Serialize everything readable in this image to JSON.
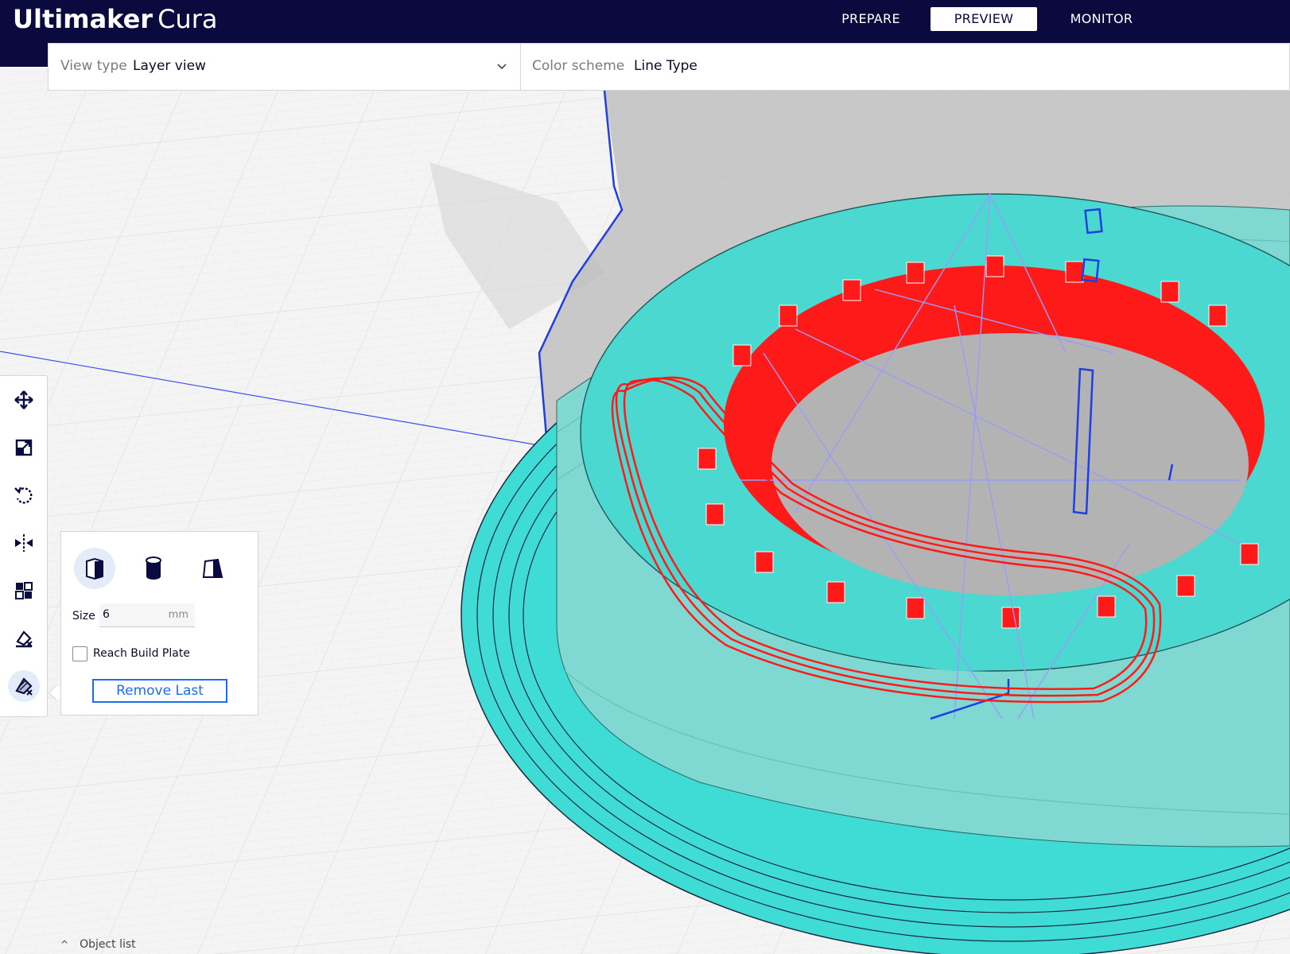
{
  "app": {
    "brand": "Ultimaker",
    "product": "Cura"
  },
  "nav": {
    "tabs": [
      {
        "label": "PREPARE",
        "active": false
      },
      {
        "label": "PREVIEW",
        "active": true
      },
      {
        "label": "MONITOR",
        "active": false
      }
    ]
  },
  "viewbar": {
    "view_type_label": "View type",
    "view_type_value": "Layer view",
    "color_scheme_label": "Color scheme",
    "color_scheme_value": "Line Type"
  },
  "toolbar": {
    "tools": [
      "move-icon",
      "scale-icon",
      "rotate-icon",
      "mirror-icon",
      "per-model-settings-icon",
      "support-blocker-icon",
      "support-eraser-icon"
    ],
    "active_tool": "support-eraser-icon"
  },
  "support_panel": {
    "shapes": [
      "cube-icon",
      "cylinder-icon",
      "custom-mesh-icon"
    ],
    "active_shape": "cube-icon",
    "size_label": "Size",
    "size_value": "6",
    "size_unit": "mm",
    "reach_build_plate_label": "Reach Build Plate",
    "reach_build_plate_checked": false,
    "remove_last_label": "Remove Last"
  },
  "object_list": {
    "label": "Object list"
  },
  "colors": {
    "header": "#0a0a3e",
    "accent": "#196ef0",
    "shell": "#3fdcd6",
    "wall": "#ff1a1a",
    "travel": "#9a9cf8"
  }
}
